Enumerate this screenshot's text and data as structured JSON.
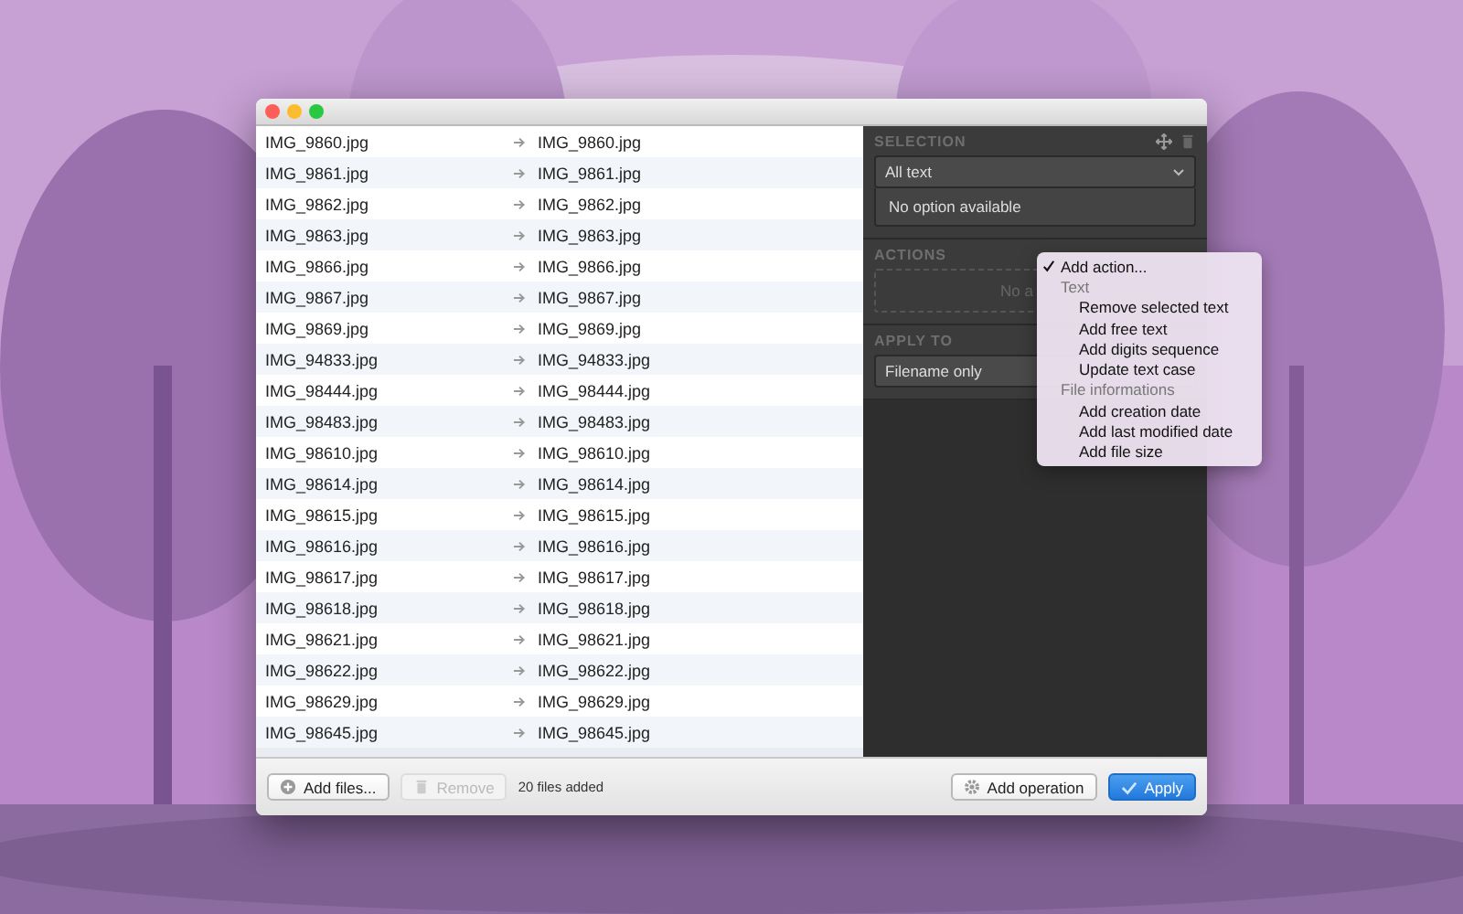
{
  "files": [
    {
      "original": "IMG_9860.jpg",
      "renamed": "IMG_9860.jpg"
    },
    {
      "original": "IMG_9861.jpg",
      "renamed": "IMG_9861.jpg"
    },
    {
      "original": "IMG_9862.jpg",
      "renamed": "IMG_9862.jpg"
    },
    {
      "original": "IMG_9863.jpg",
      "renamed": "IMG_9863.jpg"
    },
    {
      "original": "IMG_9866.jpg",
      "renamed": "IMG_9866.jpg"
    },
    {
      "original": "IMG_9867.jpg",
      "renamed": "IMG_9867.jpg"
    },
    {
      "original": "IMG_9869.jpg",
      "renamed": "IMG_9869.jpg"
    },
    {
      "original": "IMG_94833.jpg",
      "renamed": "IMG_94833.jpg"
    },
    {
      "original": "IMG_98444.jpg",
      "renamed": "IMG_98444.jpg"
    },
    {
      "original": "IMG_98483.jpg",
      "renamed": "IMG_98483.jpg"
    },
    {
      "original": "IMG_98610.jpg",
      "renamed": "IMG_98610.jpg"
    },
    {
      "original": "IMG_98614.jpg",
      "renamed": "IMG_98614.jpg"
    },
    {
      "original": "IMG_98615.jpg",
      "renamed": "IMG_98615.jpg"
    },
    {
      "original": "IMG_98616.jpg",
      "renamed": "IMG_98616.jpg"
    },
    {
      "original": "IMG_98617.jpg",
      "renamed": "IMG_98617.jpg"
    },
    {
      "original": "IMG_98618.jpg",
      "renamed": "IMG_98618.jpg"
    },
    {
      "original": "IMG_98621.jpg",
      "renamed": "IMG_98621.jpg"
    },
    {
      "original": "IMG_98622.jpg",
      "renamed": "IMG_98622.jpg"
    },
    {
      "original": "IMG_98629.jpg",
      "renamed": "IMG_98629.jpg"
    },
    {
      "original": "IMG_98645.jpg",
      "renamed": "IMG_98645.jpg"
    }
  ],
  "panel": {
    "selection": {
      "title": "SELECTION",
      "dropdown": "All text",
      "options_text": "No option available"
    },
    "actions": {
      "title": "ACTIONS",
      "placeholder_text": "No a"
    },
    "apply_to": {
      "title": "APPLY TO",
      "dropdown": "Filename only"
    }
  },
  "action_menu": [
    {
      "kind": "item",
      "label": "Add action...",
      "checked": true
    },
    {
      "kind": "header",
      "label": "Text"
    },
    {
      "kind": "item",
      "label": "Remove selected text",
      "checked": false
    },
    {
      "kind": "item",
      "label": "Add free text",
      "checked": false
    },
    {
      "kind": "item",
      "label": "Add digits sequence",
      "checked": false
    },
    {
      "kind": "item",
      "label": "Update text case",
      "checked": false
    },
    {
      "kind": "header",
      "label": "File informations"
    },
    {
      "kind": "item",
      "label": "Add creation date",
      "checked": false
    },
    {
      "kind": "item",
      "label": "Add last modified date",
      "checked": false
    },
    {
      "kind": "item",
      "label": "Add file size",
      "checked": false
    }
  ],
  "bottom_bar": {
    "add_files": "Add files...",
    "remove": {
      "label": "Remove",
      "disabled": true
    },
    "status": "20 files added",
    "add_operation": "Add operation",
    "apply": "Apply"
  }
}
